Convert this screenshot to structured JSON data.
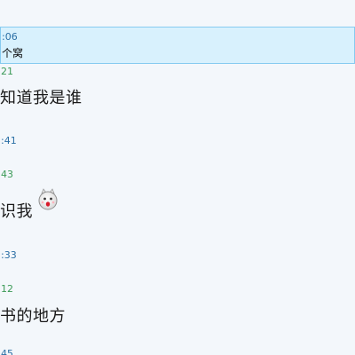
{
  "selected": {
    "time": ":06",
    "text": "个窝"
  },
  "messages": [
    {
      "time": "21",
      "time_color": "green",
      "text": "知道我是谁"
    },
    {
      "time": ":41",
      "time_color": "blue",
      "text": ""
    },
    {
      "time": "43",
      "time_color": "green",
      "text": "识我",
      "emoji": "white-cat-face-icon"
    },
    {
      "time": ":33",
      "time_color": "blue",
      "text": ""
    },
    {
      "time": "12",
      "time_color": "green",
      "text": "书的地方"
    },
    {
      "time": "45",
      "time_color": "blue",
      "text": ""
    }
  ],
  "colors": {
    "background": "#f3f7fb",
    "selected_background": "#d8f1fd",
    "selected_border": "#86cbf0",
    "time_green": "#3b9a57",
    "time_blue": "#2b6fa5"
  }
}
